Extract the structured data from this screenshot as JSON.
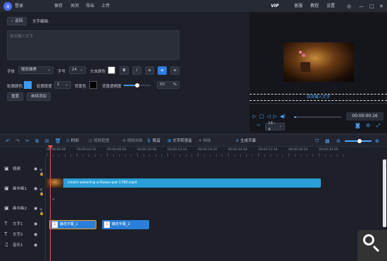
{
  "titlebar": {
    "logo_char": "a",
    "login": "登录",
    "menu": [
      "保存",
      "关闭",
      "导出",
      "上传"
    ],
    "vip": "VIP",
    "links": [
      "客服",
      "教程",
      "设置"
    ],
    "window_controls": [
      "skin-icon",
      "minimize-icon",
      "maximize-icon",
      "close-icon"
    ]
  },
  "editor": {
    "back_label": "返回",
    "section_title": "文字编辑:",
    "text_placeholder": "双击输入文字",
    "font_label": "字体",
    "font_value": "微软雅黑",
    "size_label": "字号",
    "size_value": "24",
    "text_color_label": "文本颜色",
    "text_color": "#ffffff",
    "style_buttons": [
      "B",
      "I",
      "≡",
      "≡",
      "≡"
    ],
    "outline_color_label": "轮廓颜色",
    "outline_color": "#3d9bf5",
    "outline_width_label": "轮廓厚度",
    "outline_width_value": "1",
    "bg_color_label": "背景色",
    "bg_color": "#000000",
    "bg_opacity_label": "背景透明度",
    "bg_opacity_value": "50",
    "bg_opacity_unit": "%",
    "reset_label": "重置",
    "continue_add_label": "继续添加"
  },
  "preview": {
    "caption": "双击输入文字",
    "time": "00:00:00.16",
    "aspect": "16 : 9",
    "progress": 0.05
  },
  "toolbar": {
    "tools": [
      "时间",
      "视频抠图",
      "视频去除",
      "配音",
      "文字转语音",
      "特效",
      "生成字幕"
    ]
  },
  "ruler": {
    "ticks": [
      "00:00:00:00",
      "00:00:03:10",
      "00:00:06:20",
      "00:00:10:00",
      "00:00:13:10",
      "00:00:16:20",
      "00:00:20:00",
      "00:00:23:10",
      "00:00:26:20",
      "00:00:30:00"
    ]
  },
  "tracks": [
    {
      "label": "视频",
      "icon": "video-track-icon"
    },
    {
      "label": "画中画1",
      "icon": "pip-track-icon"
    },
    {
      "label": "画中画2",
      "icon": "pip-track-icon"
    },
    {
      "label": "文字1",
      "icon": "text-track-icon"
    },
    {
      "label": "文字2",
      "icon": "text-track-icon"
    },
    {
      "label": "音乐1",
      "icon": "music-track-icon"
    }
  ],
  "clips": {
    "video": "mixkit-watering-a-flower-pot-1780.mp4",
    "text1_num": "1",
    "text1": "静态字幕_1",
    "text2_num": "1",
    "text2": "静态字幕_2"
  }
}
